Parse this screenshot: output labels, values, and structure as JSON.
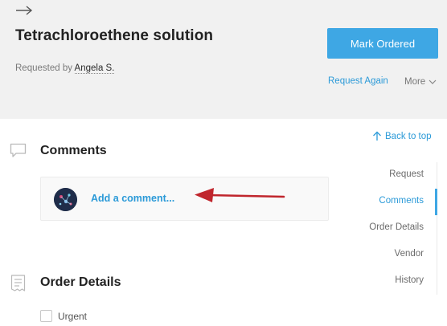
{
  "header": {
    "title": "Tetrachloroethene solution",
    "requested_by_label": "Requested by",
    "requester": "Angela S.",
    "mark_button": "Mark Ordered",
    "request_again": "Request Again",
    "more": "More",
    "icons": {
      "back": "arrow-right-icon",
      "more": "chevron-down-icon"
    }
  },
  "back_to_top": "Back to top",
  "comments": {
    "title": "Comments",
    "placeholder": "Add a comment..."
  },
  "order_details": {
    "title": "Order Details",
    "urgent_label": "Urgent"
  },
  "nav": {
    "items": [
      {
        "label": "Request",
        "active": false
      },
      {
        "label": "Comments",
        "active": true
      },
      {
        "label": "Order Details",
        "active": false
      },
      {
        "label": "Vendor",
        "active": false
      },
      {
        "label": "History",
        "active": false
      }
    ]
  },
  "colors": {
    "accent": "#3ea7e4",
    "link": "#2b9ad8",
    "header_bg": "#f1f1f1",
    "annotation": "#c0262d"
  }
}
